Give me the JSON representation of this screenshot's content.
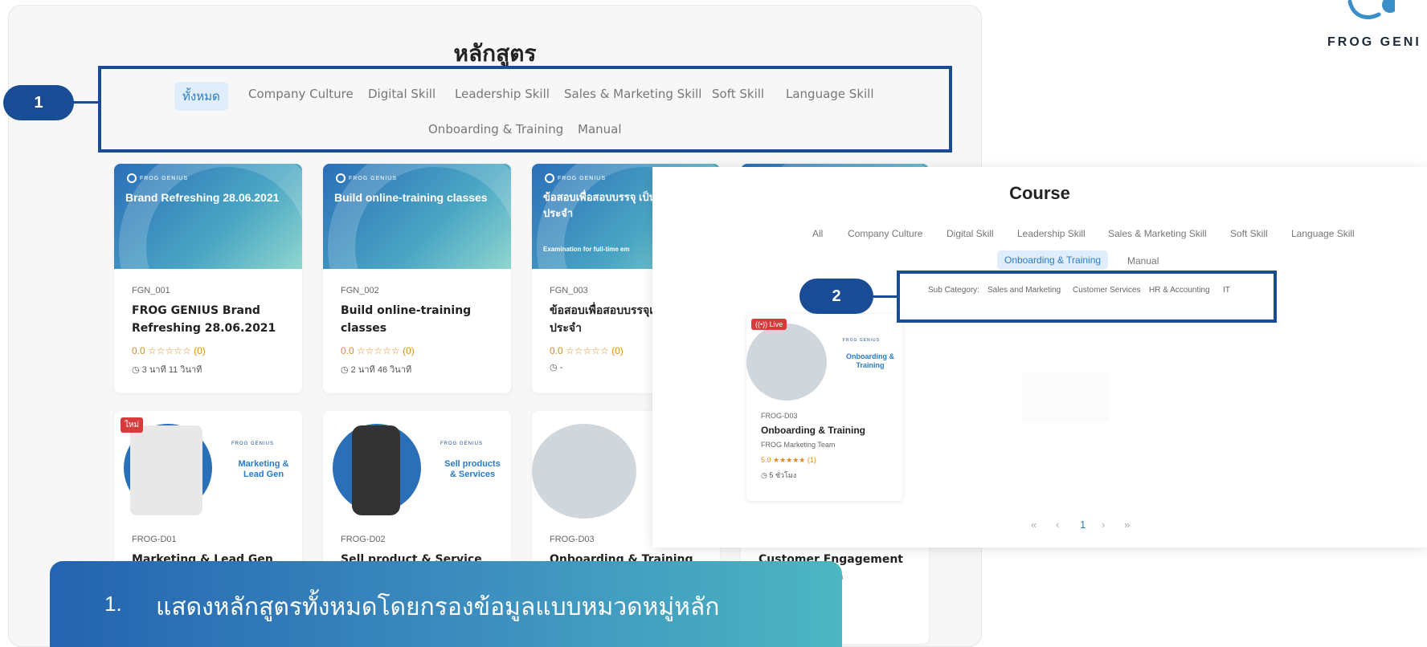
{
  "main": {
    "title": "หลักสูตร",
    "tabs": [
      "ทั้งหมด",
      "Company Culture",
      "Digital Skill",
      "Leadership Skill",
      "Sales & Marketing Skill",
      "Soft Skill",
      "Language Skill",
      "Onboarding & Training",
      "Manual"
    ],
    "active_tab": "ทั้งหมด",
    "cards_row1": [
      {
        "banner_title": "Brand Refreshing 28.06.2021",
        "code": "FGN_001",
        "title": "FROG GENIUS Brand Refreshing 28.06.2021",
        "rating": "0.0 ☆☆☆☆☆ (0)",
        "duration": "◷ 3 นาที 11 วินาที"
      },
      {
        "banner_title": "Build online-training classes",
        "code": "FGN_002",
        "title": "Build online-training classes",
        "rating": "0.0 ☆☆☆☆☆ (0)",
        "duration": "◷ 2 นาที 46 วินาที"
      },
      {
        "banner_title": "ข้อสอบเพื่อสอบบรรจุ เป็นพนักงานประจำ",
        "banner_sub": "Examination for full-time em",
        "code": "FGN_003",
        "title": "ข้อสอบเพื่อสอบบรรจุเป็นพนักงานประจำ",
        "rating": "0.0 ☆☆☆☆☆ (0)",
        "duration": "◷ -"
      }
    ],
    "cards_row2": [
      {
        "badge": "ใหม่",
        "thumb_text": "Marketing & Lead Gen",
        "code": "FROG-D01",
        "title": "Marketing & Lead Gen"
      },
      {
        "thumb_text": "Sell products & Services",
        "code": "FROG-D02",
        "title": "Sell product & Service"
      },
      {
        "code": "FROG-D03",
        "title": "Onboarding & Training"
      },
      {
        "title": "Customer Engagement",
        "author_partial": "am"
      }
    ],
    "brand_small": "FROG GENIUS"
  },
  "callouts": {
    "one": "1",
    "two": "2"
  },
  "overlay": {
    "title": "Course",
    "tabs_row1": [
      "All",
      "Company Culture",
      "Digital Skill",
      "Leadership Skill",
      "Sales & Marketing Skill",
      "Soft Skill",
      "Language Skill"
    ],
    "tabs_row2": [
      "Onboarding & Training",
      "Manual"
    ],
    "active_tab": "Onboarding & Training",
    "sub_label": "Sub Category:",
    "sub_items": [
      "Sales and Marketing",
      "Customer Services",
      "HR & Accounting",
      "IT"
    ],
    "card": {
      "badge": "((•)) Live",
      "thumb_text": "Onboarding & Training",
      "code": "FROG-D03",
      "title": "Onboarding & Training",
      "author": "FROG Marketing Team",
      "rating": "5.0 ★★★★★ (1)",
      "duration": "◷ 5 ชั่วโมง"
    },
    "pager": [
      "«",
      "‹",
      "1",
      "›",
      "»"
    ]
  },
  "bottom_banner": {
    "number": "1.",
    "text": "แสดงหลักสูตรทั้งหมดโดยกรองข้อมูลแบบหมวดหมู่หลัก"
  },
  "logo": {
    "text": "FROG GENI"
  },
  "colors": {
    "accent": "#1a4c96",
    "tab_active_bg": "#dfeefa",
    "rating": "#e08a1e",
    "badge": "#d73b3b"
  }
}
